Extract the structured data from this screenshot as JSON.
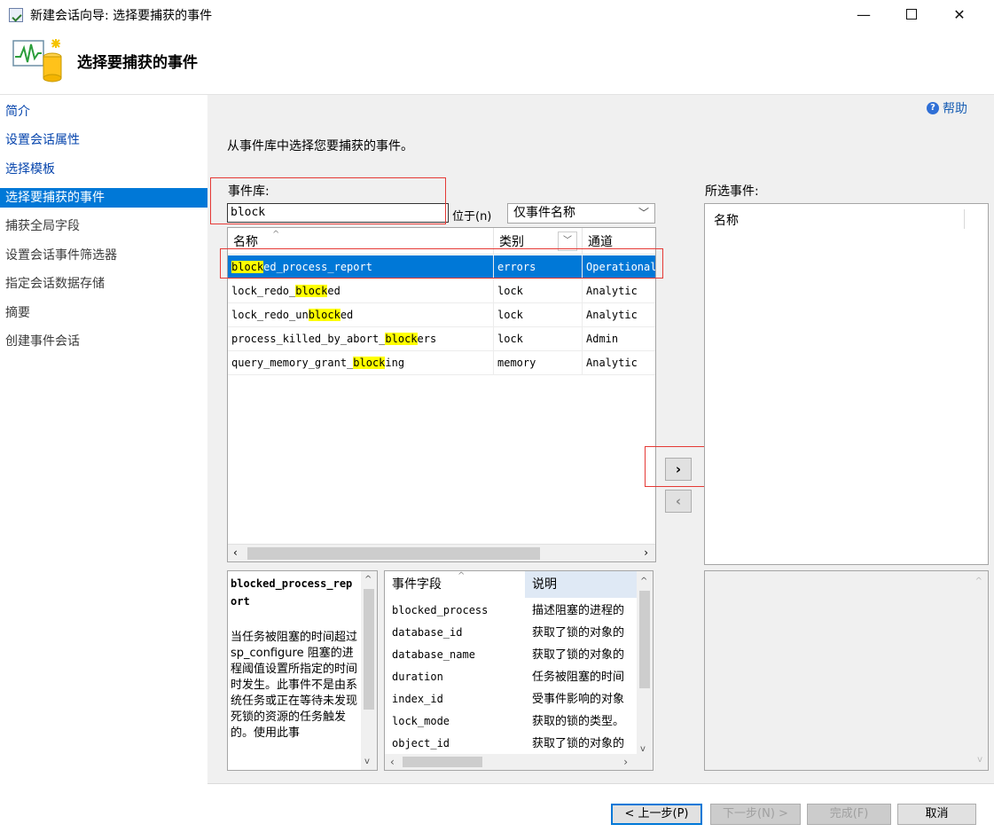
{
  "window": {
    "title": "新建会话向导: 选择要捕获的事件"
  },
  "header": {
    "title": "选择要捕获的事件"
  },
  "nav": {
    "items": [
      {
        "label": "简介"
      },
      {
        "label": "设置会话属性"
      },
      {
        "label": "选择模板"
      },
      {
        "label": "选择要捕获的事件"
      },
      {
        "label": "捕获全局字段"
      },
      {
        "label": "设置会话事件筛选器"
      },
      {
        "label": "指定会话数据存储"
      },
      {
        "label": "摘要"
      },
      {
        "label": "创建事件会话"
      }
    ]
  },
  "help": {
    "label": "帮助"
  },
  "instruction": "从事件库中选择您要捕获的事件。",
  "library": {
    "label": "事件库:",
    "search_value": "block",
    "locate_label": "位于(n)",
    "scope_value": "仅事件名称"
  },
  "events_table": {
    "columns": [
      "名称",
      "类别",
      "通道"
    ],
    "rows": [
      {
        "name_hl": "block",
        "name_rest": "ed_process_report",
        "name_pre": "",
        "category": "errors",
        "channel": "Operational"
      },
      {
        "name_pre": "lock_redo_",
        "name_hl": "block",
        "name_rest": "ed",
        "category": "lock",
        "channel": "Analytic"
      },
      {
        "name_pre": "lock_redo_un",
        "name_hl": "block",
        "name_rest": "ed",
        "category": "lock",
        "channel": "Analytic"
      },
      {
        "name_pre": "process_killed_by_abort_",
        "name_hl": "block",
        "name_rest": "ers",
        "category": "lock",
        "channel": "Admin"
      },
      {
        "name_pre": "query_memory_grant_",
        "name_hl": "block",
        "name_rest": "ing",
        "category": "memory",
        "channel": "Analytic"
      }
    ]
  },
  "move": {
    "add": "›",
    "remove": "‹"
  },
  "selected_events": {
    "label": "所选事件:",
    "column": "名称"
  },
  "description": {
    "title": "blocked_process_report",
    "body": "当任务被阻塞的时间超过 sp_configure 阻塞的进程阈值设置所指定的时间时发生。此事件不是由系统任务或正在等待未发现死锁的资源的任务触发的。使用此事"
  },
  "fields_table": {
    "columns": [
      "事件字段",
      "说明"
    ],
    "rows": [
      {
        "field": "blocked_process",
        "desc": "描述阻塞的进程的"
      },
      {
        "field": "database_id",
        "desc": "获取了锁的对象的"
      },
      {
        "field": "database_name",
        "desc": "获取了锁的对象的"
      },
      {
        "field": "duration",
        "desc": "任务被阻塞的时间"
      },
      {
        "field": "index_id",
        "desc": "受事件影响的对象"
      },
      {
        "field": "lock_mode",
        "desc": "获取的锁的类型。"
      },
      {
        "field": "object_id",
        "desc": "获取了锁的对象的"
      }
    ]
  },
  "buttons": {
    "back": "< 上一步(P)",
    "next": "下一步(N) >",
    "finish": "完成(F)",
    "cancel": "取消"
  },
  "colors": {
    "accent": "#0078d7",
    "highlight": "#ffff00",
    "annotation": "#e53935"
  }
}
